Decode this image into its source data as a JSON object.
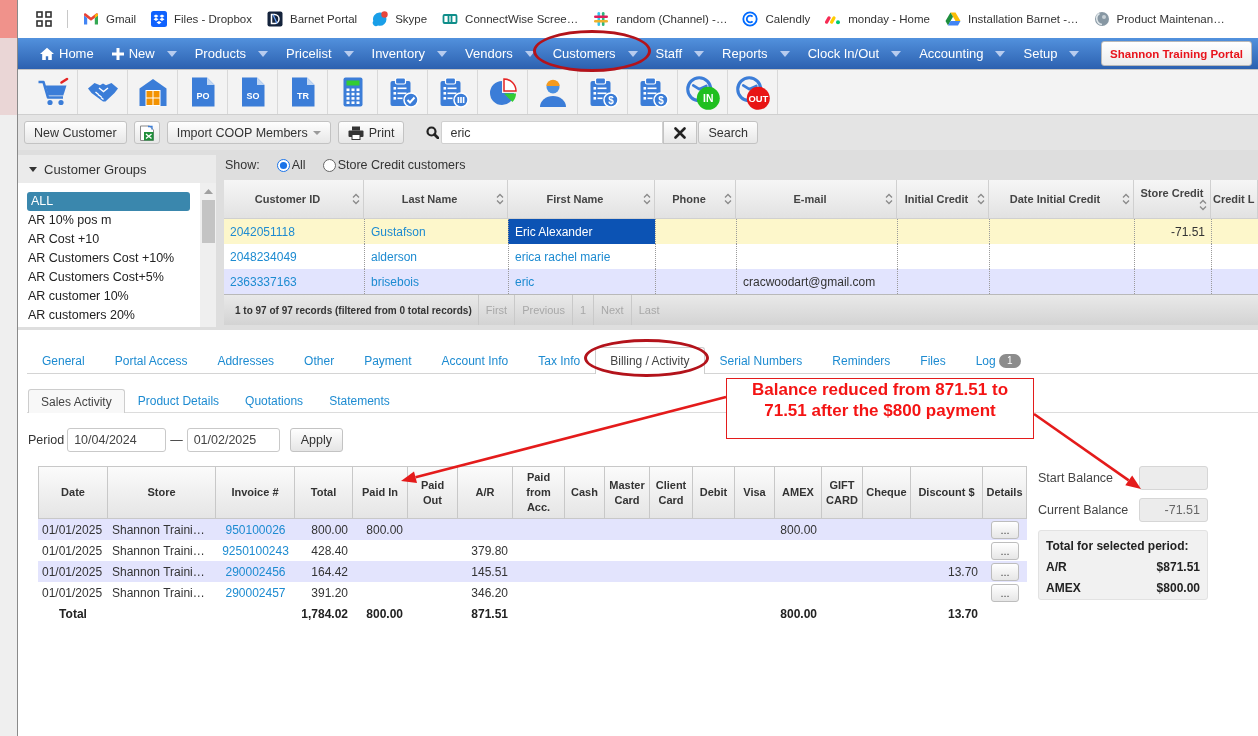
{
  "bookmarks_bar": {
    "items": [
      {
        "kind": "mail",
        "label": "Gmail"
      },
      {
        "kind": "box",
        "label": "Files - Dropbox"
      },
      {
        "kind": "portal",
        "label": "Barnet Portal"
      },
      {
        "kind": "chat",
        "label": "Skype"
      },
      {
        "kind": "squares",
        "label": "ConnectWise Scree…"
      },
      {
        "kind": "hash",
        "label": "random (Channel) -…"
      },
      {
        "kind": "ring",
        "label": "Calendly"
      },
      {
        "kind": "dots",
        "label": "monday - Home"
      },
      {
        "kind": "drive",
        "label": "Installation Barnet -…"
      },
      {
        "kind": "sphere",
        "label": "Product Maintenan…"
      }
    ]
  },
  "nav": {
    "items": [
      {
        "label": "Home",
        "kind": "home",
        "dropdown": false,
        "highlighted": false
      },
      {
        "label": "New",
        "kind": "new",
        "dropdown": true,
        "highlighted": false
      },
      {
        "label": "Products",
        "kind": "menu",
        "dropdown": true,
        "highlighted": false
      },
      {
        "label": "Pricelist",
        "kind": "menu",
        "dropdown": true,
        "highlighted": false
      },
      {
        "label": "Inventory",
        "kind": "menu",
        "dropdown": true,
        "highlighted": false
      },
      {
        "label": "Vendors",
        "kind": "menu",
        "dropdown": true,
        "highlighted": false
      },
      {
        "label": "Customers",
        "kind": "menu",
        "dropdown": true,
        "highlighted": true
      },
      {
        "label": "Staff",
        "kind": "menu",
        "dropdown": true,
        "highlighted": false
      },
      {
        "label": "Reports",
        "kind": "menu",
        "dropdown": true,
        "highlighted": false
      },
      {
        "label": "Clock In/Out",
        "kind": "menu",
        "dropdown": true,
        "highlighted": false
      },
      {
        "label": "Accounting",
        "kind": "menu",
        "dropdown": true,
        "highlighted": false
      },
      {
        "label": "Setup",
        "kind": "menu",
        "dropdown": true,
        "highlighted": false
      }
    ],
    "portal_button": "Shannon Training Portal"
  },
  "toolbar": [
    {
      "kind": "cart"
    },
    {
      "kind": "handshake"
    },
    {
      "kind": "warehouse"
    },
    {
      "kind": "document",
      "label": "PO"
    },
    {
      "kind": "document",
      "label": "SO"
    },
    {
      "kind": "document",
      "label": "TR"
    },
    {
      "kind": "calculator"
    },
    {
      "kind": "clipboard-check"
    },
    {
      "kind": "clipboard-bars"
    },
    {
      "kind": "pie-chart"
    },
    {
      "kind": "person"
    },
    {
      "kind": "clipboard-coin",
      "label": "$"
    },
    {
      "kind": "clipboard-coin",
      "label": "$"
    },
    {
      "kind": "clock",
      "label": "IN",
      "color": "#1fbf1f"
    },
    {
      "kind": "clock",
      "label": "OUT",
      "color": "#e81414"
    }
  ],
  "actions": {
    "new_customer": "New Customer",
    "import_button": "Import COOP Members",
    "print_button": "Print",
    "search": {
      "value": "eric",
      "button": "Search"
    }
  },
  "customer_groups": {
    "title": "Customer Groups",
    "expanded": true,
    "items": [
      {
        "label": "ALL",
        "selected": true
      },
      {
        "label": "AR 10% pos m",
        "selected": false
      },
      {
        "label": "AR Cost +10",
        "selected": false
      },
      {
        "label": "AR Customers Cost +10%",
        "selected": false
      },
      {
        "label": "AR Customers Cost+5%",
        "selected": false
      },
      {
        "label": "AR customer 10%",
        "selected": false
      },
      {
        "label": "AR customers 20%",
        "selected": false
      }
    ]
  },
  "customer_filter": {
    "label": "Show:",
    "options": [
      {
        "label": "All",
        "selected": true
      },
      {
        "label": "Store Credit customers",
        "selected": false
      }
    ]
  },
  "customers_table": {
    "columns": [
      {
        "label": "Customer ID",
        "kind": "link",
        "sortable": true
      },
      {
        "label": "Last Name",
        "kind": "link",
        "sortable": true
      },
      {
        "label": "First Name",
        "kind": "link",
        "sortable": true
      },
      {
        "label": "Phone",
        "kind": "text",
        "sortable": true
      },
      {
        "label": "E-mail",
        "kind": "text",
        "sortable": true
      },
      {
        "label": "Initial Credit",
        "kind": "number",
        "sortable": true
      },
      {
        "label": "Date Initial Credit",
        "kind": "text",
        "sortable": true
      },
      {
        "label": "Store Credit",
        "kind": "number",
        "sortable": true
      },
      {
        "label": "Credit L",
        "kind": "number",
        "sortable": false
      }
    ],
    "rows": [
      {
        "selected": true,
        "cells": [
          {
            "text": "2042051118",
            "focused": false
          },
          {
            "text": "Gustafson",
            "focused": false
          },
          {
            "text": "Eric Alexander",
            "focused": true
          },
          null,
          null,
          null,
          null,
          {
            "text": "-71.51",
            "focused": false
          },
          null
        ]
      },
      {
        "selected": false,
        "cells": [
          {
            "text": "2048234049",
            "focused": false
          },
          {
            "text": "alderson",
            "focused": false
          },
          {
            "text": "erica rachel marie",
            "focused": false
          },
          null,
          null,
          null,
          null,
          null,
          null
        ]
      },
      {
        "selected": false,
        "cells": [
          {
            "text": "2363337163",
            "focused": false
          },
          {
            "text": "brisebois",
            "focused": false
          },
          {
            "text": "eric",
            "focused": false
          },
          null,
          {
            "text": "cracwoodart@gmail.com",
            "focused": false
          },
          null,
          null,
          null,
          null
        ]
      }
    ],
    "info": "1 to 97 of 97 records (filtered from 0 total records)",
    "pages": [
      {
        "label": "First",
        "disabled": true
      },
      {
        "label": "Previous",
        "disabled": true
      },
      {
        "label": "1",
        "disabled": true
      },
      {
        "label": "Next",
        "disabled": true
      },
      {
        "label": "Last",
        "disabled": true
      }
    ]
  },
  "detail_tabs": [
    {
      "label": "General",
      "selected": false,
      "highlighted": false
    },
    {
      "label": "Portal Access",
      "selected": false,
      "highlighted": false
    },
    {
      "label": "Addresses",
      "selected": false,
      "highlighted": false
    },
    {
      "label": "Other",
      "selected": false,
      "highlighted": false
    },
    {
      "label": "Payment",
      "selected": false,
      "highlighted": false
    },
    {
      "label": "Account Info",
      "selected": false,
      "highlighted": false
    },
    {
      "label": "Tax Info",
      "selected": false,
      "highlighted": false
    },
    {
      "label": "Billing / Activity",
      "selected": true,
      "highlighted": true
    },
    {
      "label": "Serial Numbers",
      "selected": false,
      "highlighted": false
    },
    {
      "label": "Reminders",
      "selected": false,
      "highlighted": false
    },
    {
      "label": "Files",
      "selected": false,
      "highlighted": false
    },
    {
      "label": "Log",
      "selected": false,
      "highlighted": false,
      "badge": "1"
    }
  ],
  "sub_tabs": [
    {
      "label": "Sales Activity",
      "selected": true
    },
    {
      "label": "Product Details",
      "selected": false
    },
    {
      "label": "Quotations",
      "selected": false
    },
    {
      "label": "Statements",
      "selected": false
    }
  ],
  "period": {
    "label": "Period",
    "from": "10/04/2024",
    "separator": "—",
    "to": "01/02/2025",
    "button": "Apply"
  },
  "sales_table": {
    "columns": [
      {
        "label": "Date",
        "kind": "text",
        "arrow_target": false
      },
      {
        "label": "Store",
        "kind": "text",
        "arrow_target": false
      },
      {
        "label": "Invoice #",
        "kind": "link",
        "arrow_target": false
      },
      {
        "label": "Total",
        "kind": "number",
        "arrow_target": false
      },
      {
        "label": "Paid In",
        "kind": "number",
        "arrow_target": true
      },
      {
        "label": "Paid Out",
        "kind": "number",
        "arrow_target": false
      },
      {
        "label": "A/R",
        "kind": "number",
        "arrow_target": false
      },
      {
        "label": "Paid from Acc.",
        "kind": "number",
        "arrow_target": false
      },
      {
        "label": "Cash",
        "kind": "number",
        "arrow_target": false
      },
      {
        "label": "Master Card",
        "kind": "number",
        "arrow_target": false
      },
      {
        "label": "Client Card",
        "kind": "number",
        "arrow_target": false
      },
      {
        "label": "Debit",
        "kind": "number",
        "arrow_target": false
      },
      {
        "label": "Visa",
        "kind": "number",
        "arrow_target": false
      },
      {
        "label": "AMEX",
        "kind": "number",
        "arrow_target": false
      },
      {
        "label": "GIFT CARD",
        "kind": "number",
        "arrow_target": false
      },
      {
        "label": "Cheque",
        "kind": "number",
        "arrow_target": false
      },
      {
        "label": "Discount $",
        "kind": "number",
        "arrow_target": false
      },
      {
        "label": "Details",
        "kind": "button",
        "arrow_target": false
      }
    ],
    "rows": [
      {
        "cells": [
          "01/01/2025",
          "Shannon Traini…",
          "950100026",
          "800.00",
          "800.00",
          null,
          null,
          null,
          null,
          null,
          null,
          null,
          null,
          "800.00",
          null,
          null,
          null,
          "..."
        ]
      },
      {
        "cells": [
          "01/01/2025",
          "Shannon Traini…",
          "9250100243",
          "428.40",
          null,
          null,
          "379.80",
          null,
          null,
          null,
          null,
          null,
          null,
          null,
          null,
          null,
          null,
          "..."
        ]
      },
      {
        "cells": [
          "01/01/2025",
          "Shannon Traini…",
          "290002456",
          "164.42",
          null,
          null,
          "145.51",
          null,
          null,
          null,
          null,
          null,
          null,
          null,
          null,
          null,
          "13.70",
          "..."
        ]
      },
      {
        "cells": [
          "01/01/2025",
          "Shannon Traini…",
          "290002457",
          "391.20",
          null,
          null,
          "346.20",
          null,
          null,
          null,
          null,
          null,
          null,
          null,
          null,
          null,
          null,
          "..."
        ]
      }
    ],
    "total": {
      "cells": [
        "Total",
        null,
        null,
        "1,784.02",
        "800.00",
        null,
        "871.51",
        null,
        null,
        null,
        null,
        null,
        null,
        "800.00",
        null,
        null,
        "13.70",
        null
      ]
    }
  },
  "balance": {
    "fields": [
      {
        "label": "Start Balance",
        "arrow_target": true
      },
      {
        "label": "Current Balance",
        "value": "-71.51",
        "arrow_target": false
      }
    ],
    "summary": {
      "title": "Total for selected period:",
      "lines": [
        {
          "label": "A/R",
          "value": "$871.51"
        },
        {
          "label": "AMEX",
          "value": "$800.00"
        }
      ]
    }
  },
  "callout": {
    "text": "Balance reduced from 871.51 to 71.51 after the $800 payment"
  }
}
